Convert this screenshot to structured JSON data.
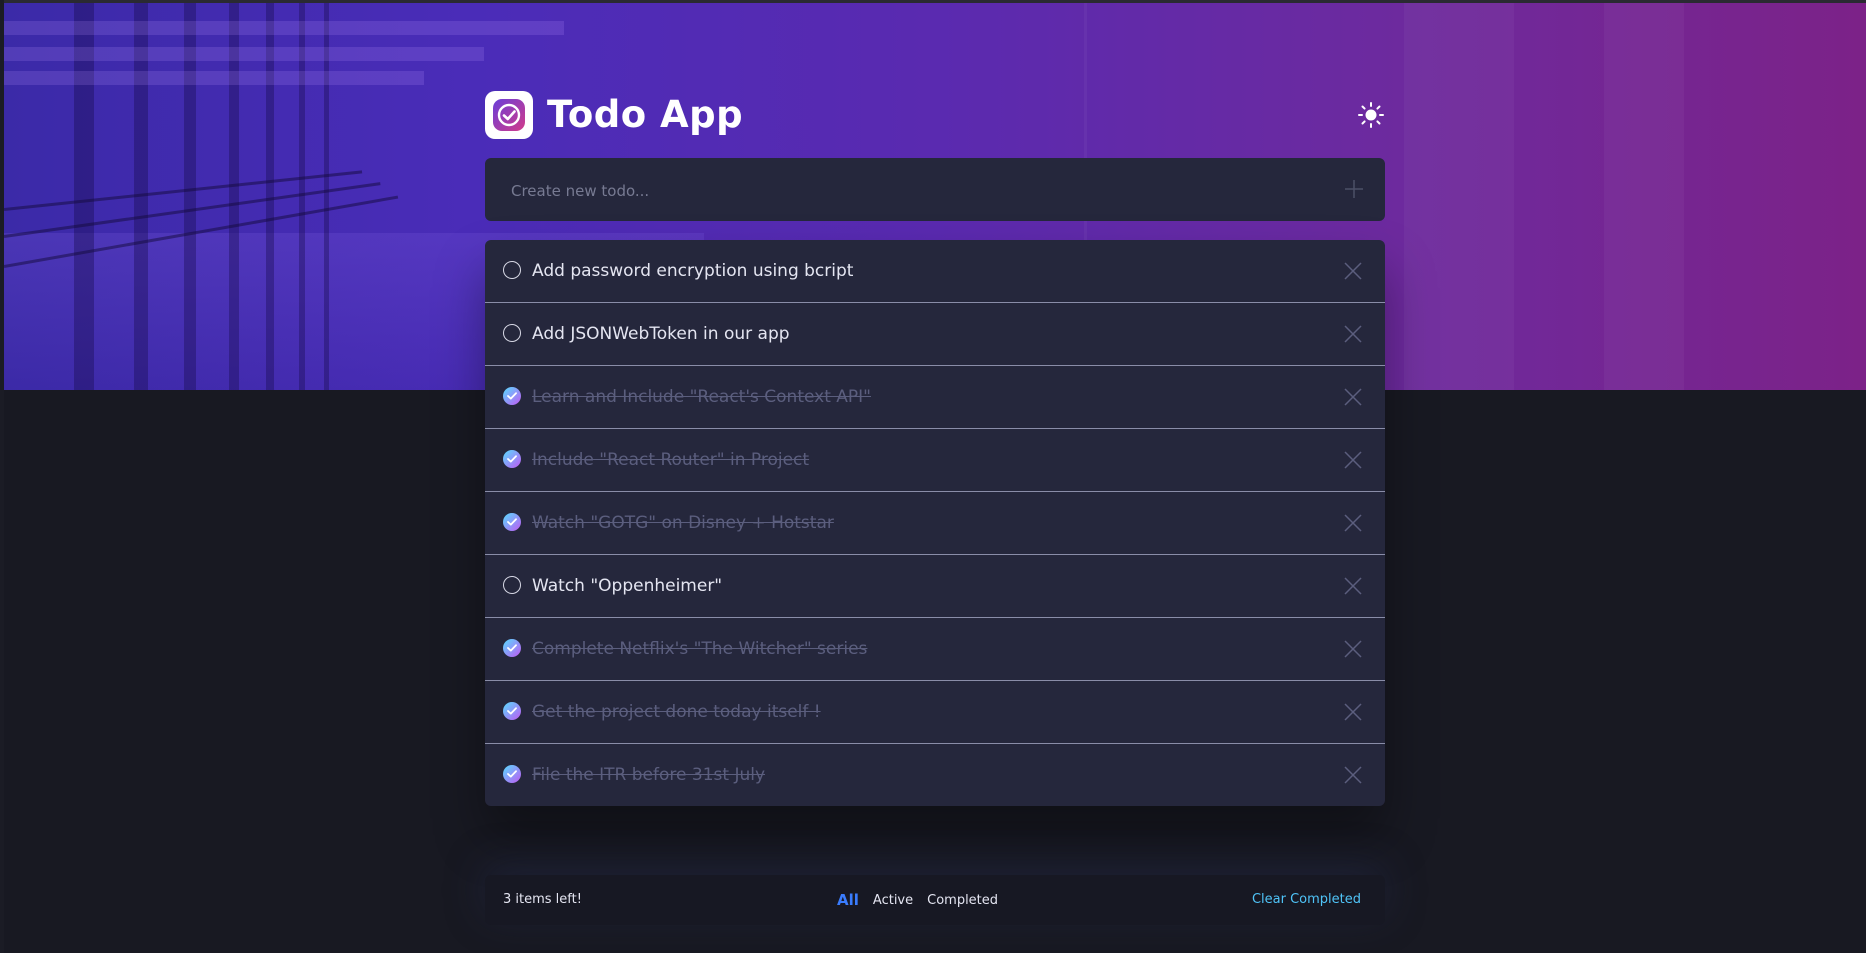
{
  "app": {
    "title": "Todo App"
  },
  "colors": {
    "accent": "#3a7cfd",
    "check_gradient_start": "#57ddff",
    "check_gradient_end": "#c058f3",
    "card": "#25273c",
    "page": "#181922"
  },
  "icons": {
    "logo": "checkmark-logo-icon",
    "theme": "sun-icon",
    "add": "plus-icon",
    "delete": "close-icon",
    "check": "checkmark-icon"
  },
  "new_todo": {
    "placeholder": "Create new todo..."
  },
  "todos": [
    {
      "text": "Add password encryption using bcript",
      "completed": false
    },
    {
      "text": "Add JSONWebToken in our app",
      "completed": false
    },
    {
      "text": "Learn and Include \"React's Context API\"",
      "completed": true
    },
    {
      "text": "Include \"React Router\" in Project",
      "completed": true
    },
    {
      "text": "Watch \"GOTG\" on Disney + Hotstar",
      "completed": true
    },
    {
      "text": "Watch \"Oppenheimer\"",
      "completed": false
    },
    {
      "text": "Complete Netflix's \"The Witcher\" series",
      "completed": true
    },
    {
      "text": "Get the project done today itself !",
      "completed": true
    },
    {
      "text": "File the ITR before 31st July",
      "completed": true
    }
  ],
  "footer": {
    "items_left": "3 items left!",
    "filters": [
      {
        "label": "All",
        "active": true
      },
      {
        "label": "Active",
        "active": false
      },
      {
        "label": "Completed",
        "active": false
      }
    ],
    "clear_label": "Clear Completed"
  }
}
